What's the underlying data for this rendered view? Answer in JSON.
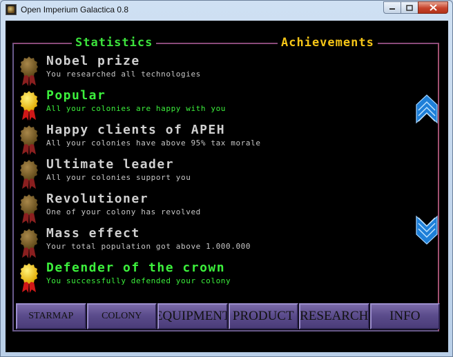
{
  "window": {
    "title": "Open Imperium Galactica 0.8"
  },
  "tabs": {
    "statistics": "Statistics",
    "achievements": "Achievements"
  },
  "achievements": [
    {
      "title": "Nobel prize",
      "desc": "You researched all technologies",
      "earned": false
    },
    {
      "title": "Popular",
      "desc": "All your colonies are happy with you",
      "earned": true
    },
    {
      "title": "Happy clients of APEH",
      "desc": "All your colonies have above 95% tax morale",
      "earned": false
    },
    {
      "title": "Ultimate leader",
      "desc": "All your colonies support you",
      "earned": false
    },
    {
      "title": "Revolutioner",
      "desc": "One of your colony has revolved",
      "earned": false
    },
    {
      "title": "Mass effect",
      "desc": "Your total population got above 1.000.000",
      "earned": false
    },
    {
      "title": "Defender of the crown",
      "desc": "You successfully defended your colony",
      "earned": true
    }
  ],
  "nav": {
    "starmap": "STARMAP",
    "colony": "COLONY",
    "equipment": "EQUIPMENT",
    "product": "PRODUCT",
    "research": "RESEARCH",
    "info": "INFO"
  },
  "colors": {
    "earned_text": "#3cf03c",
    "locked_text": "#d0d0d0",
    "tab_statistics": "#3ce23c",
    "tab_achievements": "#f5c517",
    "nav_button": "#5b4c8c"
  },
  "icons": {
    "medal_earned": "gold-medal-icon",
    "medal_locked": "bronze-medal-icon",
    "scroll_up": "scroll-up-arrow-icon",
    "scroll_down": "scroll-down-arrow-icon"
  }
}
